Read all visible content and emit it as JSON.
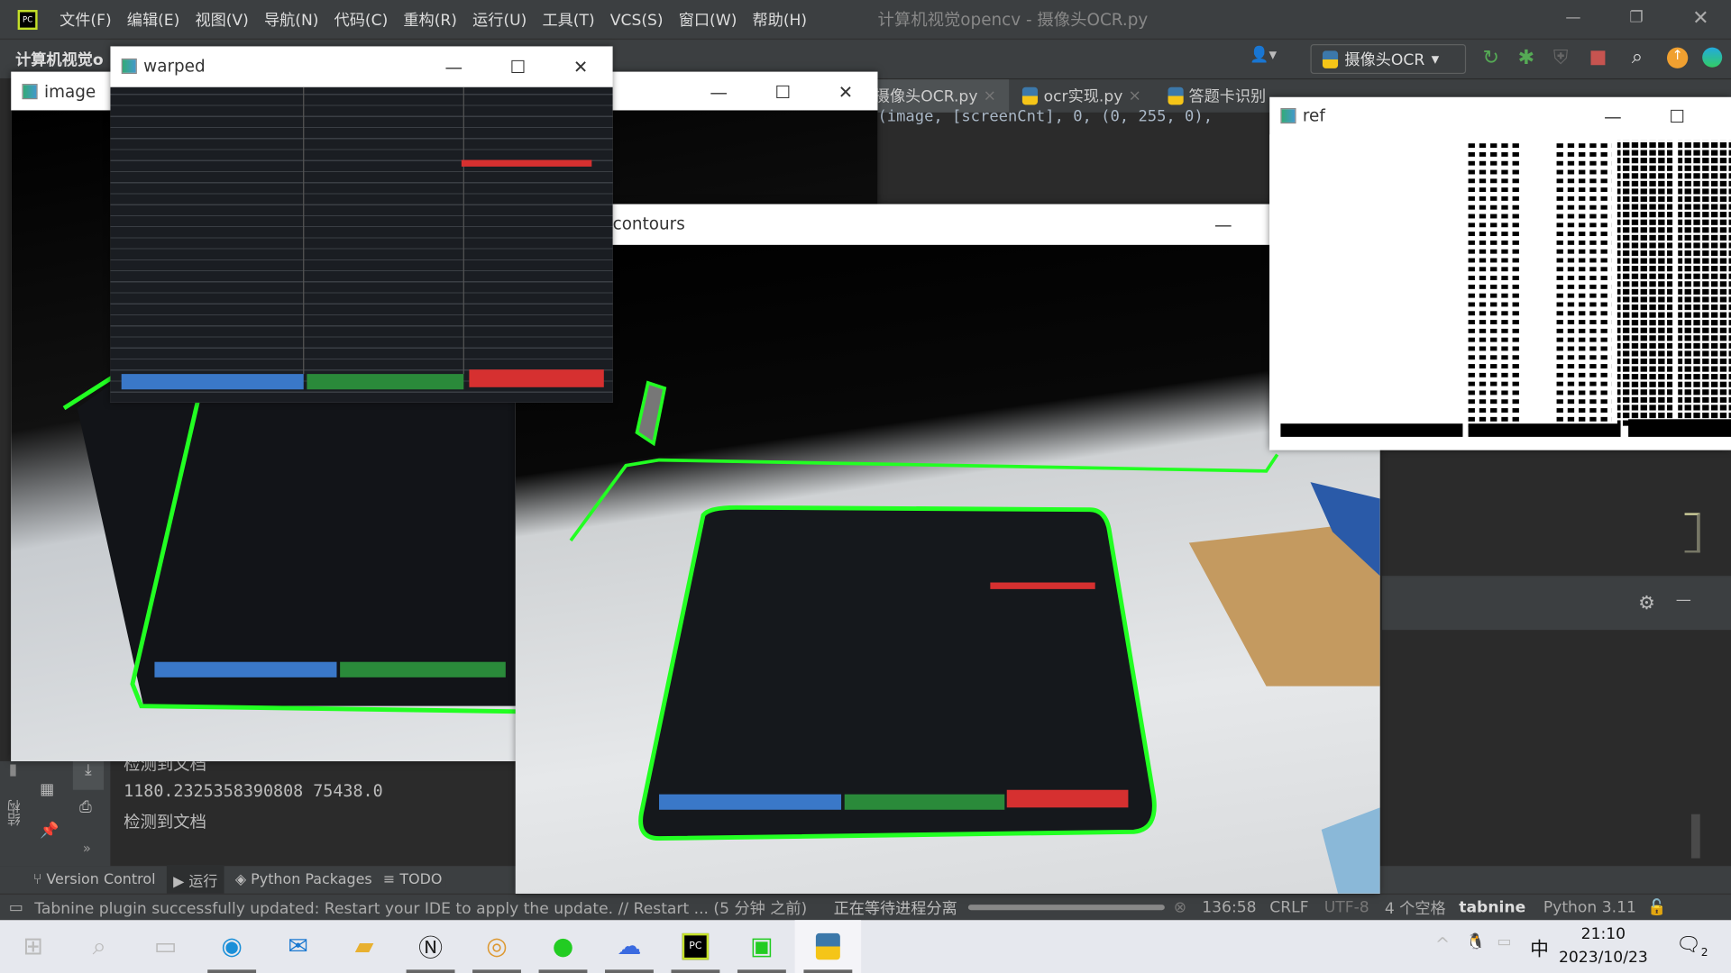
{
  "ide": {
    "menu": [
      "文件(F)",
      "编辑(E)",
      "视图(V)",
      "导航(N)",
      "代码(C)",
      "重构(R)",
      "运行(U)",
      "工具(T)",
      "VCS(S)",
      "窗口(W)",
      "帮助(H)"
    ],
    "window_title": "计算机视觉opencv - 摄像头OCR.py",
    "project_label": "计算机视觉o",
    "run_config": "摄像头OCR",
    "tabs": [
      "摄像头OCR.py",
      "ocr实现.py",
      "答题卡识别"
    ],
    "code_line": "(image, [screenCnt], 0, (0, 255, 0),",
    "console_lines": [
      "检测到文档",
      "1180.2325358390808 75438.0",
      "检测到文档"
    ],
    "side_label": "结构",
    "bottom_tools": [
      "Version Control",
      "运行",
      "Python Packages",
      "TODO"
    ],
    "status": {
      "message": "Tabnine plugin successfully updated: Restart your IDE to apply the update. // Restart ... (5 分钟 之前)",
      "process": "正在等待进程分离",
      "position": "136:58",
      "line_sep": "CRLF",
      "encoding": "UTF-8",
      "indent": "4 个空格",
      "tabnine": "tabnine",
      "interpreter": "Python 3.11"
    }
  },
  "windows": {
    "image": "image",
    "warped": "warped",
    "contours": "contours",
    "ref": "ref"
  },
  "taskbar": {
    "time": "21:10",
    "date": "2023/10/23",
    "ime": "中",
    "notifications": "2",
    "icons": [
      "start-icon",
      "search-icon",
      "task-view-icon",
      "edge-icon",
      "mail-icon",
      "explorer-icon",
      "notion-icon",
      "chrome-icon",
      "wechat-icon",
      "cloud-icon",
      "pycharm-icon",
      "screen-icon",
      "python-icon"
    ]
  },
  "colors": {
    "ide_bg": "#2b2b2b",
    "panel": "#3c3f41",
    "contour": "#22ff22"
  }
}
